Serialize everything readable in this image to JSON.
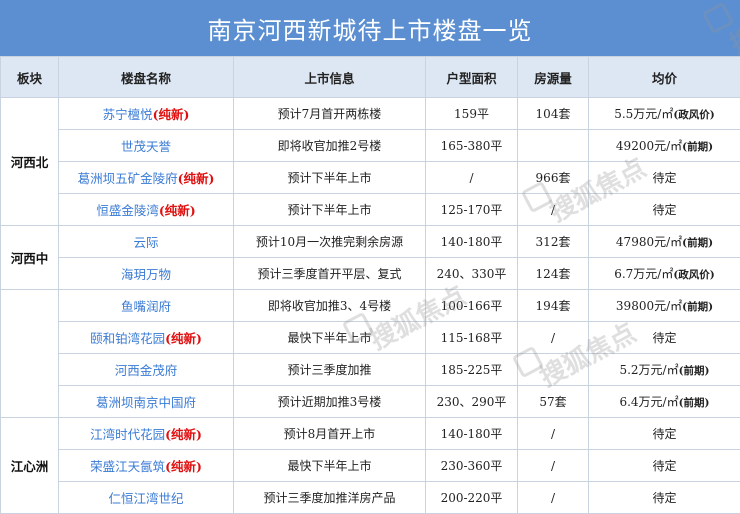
{
  "title": "南京河西新城待上市楼盘一览",
  "headers": [
    "板块",
    "楼盘名称",
    "上市信息",
    "户型面积",
    "房源量",
    "均价"
  ],
  "new_tag": "(纯新)",
  "watermark": "搜狐焦点",
  "groups": [
    {
      "region": "河西北",
      "rows": [
        {
          "name": "苏宁檀悦",
          "new": true,
          "info": "预计7月首开两栋楼",
          "area": "159平",
          "units": "104套",
          "price": "5.5万元/㎡",
          "price_note": "(政风价)"
        },
        {
          "name": "世茂天誉",
          "new": false,
          "info": "即将收官加推2号楼",
          "area": "165-380平",
          "units": "",
          "price": "49200元/㎡",
          "price_note": "(前期)"
        },
        {
          "name": "葛洲坝五矿金陵府",
          "new": true,
          "info": "预计下半年上市",
          "area": "/",
          "units": "966套",
          "price": "待定",
          "price_note": ""
        },
        {
          "name": "恒盛金陵湾",
          "new": true,
          "info": "预计下半年上市",
          "area": "125-170平",
          "units": "/",
          "price": "待定",
          "price_note": ""
        }
      ]
    },
    {
      "region": "河西中",
      "rows": [
        {
          "name": "云际",
          "new": false,
          "info": "预计10月一次推完剩余房源",
          "area": "140-180平",
          "units": "312套",
          "price": "47980元/㎡",
          "price_note": "(前期)"
        },
        {
          "name": "海玥万物",
          "new": false,
          "info": "预计三季度首开平层、复式",
          "area": "240、330平",
          "units": "124套",
          "price": "6.7万元/㎡",
          "price_note": "(政风价)"
        }
      ]
    },
    {
      "region": "",
      "rows": [
        {
          "name": "鱼嘴润府",
          "new": false,
          "info": "即将收官加推3、4号楼",
          "area": "100-166平",
          "units": "194套",
          "price": "39800元/㎡",
          "price_note": "(前期)"
        },
        {
          "name": "颐和铂湾花园",
          "new": true,
          "info": "最快下半年上市",
          "area": "115-168平",
          "units": "/",
          "price": "待定",
          "price_note": ""
        },
        {
          "name": "河西金茂府",
          "new": false,
          "info": "预计三季度加推",
          "area": "185-225平",
          "units": "",
          "price": "5.2万元/㎡",
          "price_note": "(前期)"
        },
        {
          "name": "葛洲坝南京中国府",
          "new": false,
          "info": "预计近期加推3号楼",
          "area": "230、290平",
          "units": "57套",
          "price": "6.4万元/㎡",
          "price_note": "(前期)"
        }
      ]
    },
    {
      "region": "江心洲",
      "rows": [
        {
          "name": "江湾时代花园",
          "new": true,
          "info": "预计8月首开上市",
          "area": "140-180平",
          "units": "/",
          "price": "待定",
          "price_note": ""
        },
        {
          "name": "荣盛江天氤筑",
          "new": true,
          "info": "最快下半年上市",
          "area": "230-360平",
          "units": "/",
          "price": "待定",
          "price_note": ""
        },
        {
          "name": "仁恒江湾世纪",
          "new": false,
          "info": "预计三季度加推洋房产品",
          "area": "200-220平",
          "units": "/",
          "price": "待定",
          "price_note": ""
        }
      ]
    }
  ]
}
